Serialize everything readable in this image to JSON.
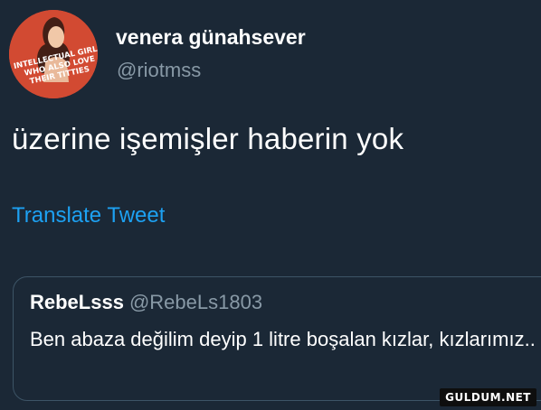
{
  "author": {
    "display_name": "venera günahsever",
    "handle": "@riotmss",
    "avatar_text": [
      "INTELLECTUAL GIRLS",
      "WHO ALSO LOVE",
      "THEIR TITTIES"
    ]
  },
  "tweet": {
    "text": "üzerine işemişler haberin yok",
    "translate_label": "Translate Tweet"
  },
  "quoted_tweet": {
    "display_name": "RebeLsss",
    "handle": "@RebeLs1803",
    "text": "Ben abaza değilim deyip 1 litre boşalan kızlar, kızlarımız.."
  },
  "watermark": "GULDUM.NET",
  "colors": {
    "background": "#1b2836",
    "link": "#1da1f2",
    "secondary_text": "#8899a6",
    "card_border": "#3d5466",
    "avatar_bg": "#d24a32"
  }
}
